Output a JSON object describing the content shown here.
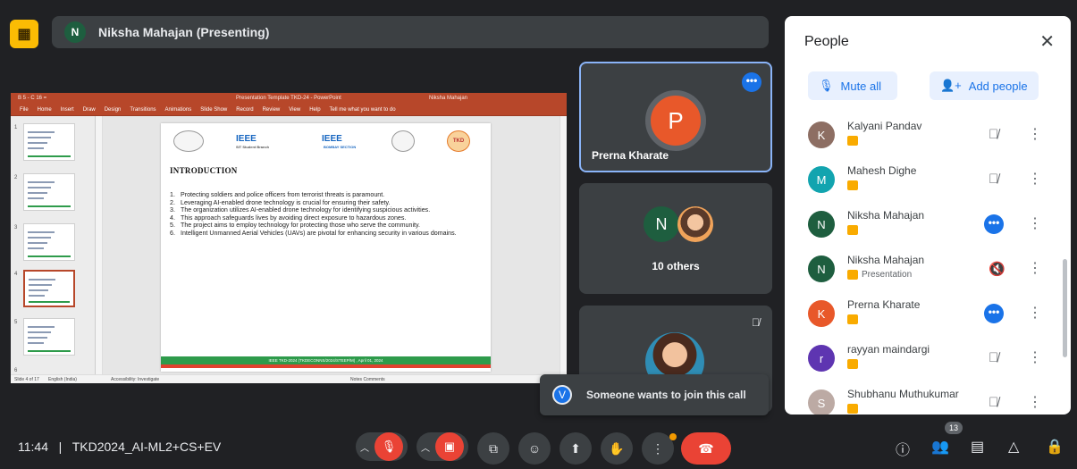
{
  "presenter": {
    "initial": "N",
    "label": "Niksha Mahajan (Presenting)"
  },
  "presentation": {
    "window_title": "Presentation Template TKD-24  -  PowerPoint",
    "user": "Niksha Mahajan",
    "quick_access": "B 5 - C 16 =",
    "ribbon_tabs": [
      "File",
      "Home",
      "Insert",
      "Draw",
      "Design",
      "Transitions",
      "Animations",
      "Slide Show",
      "Record",
      "Review",
      "View",
      "Help",
      "Tell me what you want to do"
    ],
    "slide_numbers": [
      "1",
      "2",
      "3",
      "4",
      "5",
      "6"
    ],
    "slide": {
      "logos": [
        "IEEE",
        "IEEE",
        "TKD"
      ],
      "logo_sub": [
        "SIT Student Branch",
        "BOMBAY SECTION"
      ],
      "heading": "INTRODUCTION",
      "points": [
        "Protecting soldiers and police officers from terrorist threats is paramount.",
        "Leveraging AI-enabled drone technology is crucial for ensuring their safety.",
        "The organization utilizes AI-enabled drone technology for identifying suspicious activities.",
        "This approach safeguards lives by avoiding direct exposure to hazardous zones.",
        "The project aims to employ technology for protecting those who serve the community.",
        "Intelligent Unmanned Aerial Vehicles (UAVs) are pivotal for enhancing security in various domains."
      ],
      "footer": "IEEE TKD-2024 (TKDECONNS/2024/STEEP/M) , April 01, 2024"
    },
    "status_left": "Slide 4 of 17",
    "status_lang": "English (India)",
    "status_access": "Accessibility: Investigate",
    "status_right": "Notes   Comments"
  },
  "tiles": [
    {
      "initial": "P",
      "name": "Prerna Kharate"
    },
    {
      "initial": "N",
      "label": "10 others"
    },
    {
      "name": ""
    }
  ],
  "toast": {
    "initial": "V",
    "message": "Someone wants to join this call"
  },
  "people_panel": {
    "title": "People",
    "close": "✕",
    "mute_all": "Mute all",
    "add_people": "Add people",
    "rows": [
      {
        "initial": "K",
        "name": "Kalyani Pandav",
        "color": "#8d6e63",
        "status": "muted"
      },
      {
        "initial": "M",
        "name": "Mahesh Dighe",
        "color": "#12a4af",
        "status": "muted"
      },
      {
        "initial": "N",
        "name": "Niksha Mahajan",
        "color": "#1e5e3f",
        "status": "active"
      },
      {
        "initial": "N",
        "name": "Niksha Mahajan",
        "color": "#1e5e3f",
        "status": "presentation",
        "sub": "Presentation"
      },
      {
        "initial": "K",
        "name": "Prerna Kharate",
        "color": "#e8582a",
        "status": "active"
      },
      {
        "initial": "r",
        "name": "rayyan maindargi",
        "color": "#5e35b1",
        "status": "muted"
      },
      {
        "initial": "S",
        "name": "Shubhanu Muthukumar",
        "color": "#bcaaa4",
        "status": "muted"
      }
    ]
  },
  "bottom": {
    "time": "11:44",
    "meeting": "TKD2024_AI-ML2+CS+EV",
    "people_count": "13"
  },
  "colors": {
    "accent": "#1a73e8",
    "danger": "#ea4335",
    "powerpoint": "#b7472a",
    "surface": "#3c4043",
    "bg": "#202124"
  }
}
